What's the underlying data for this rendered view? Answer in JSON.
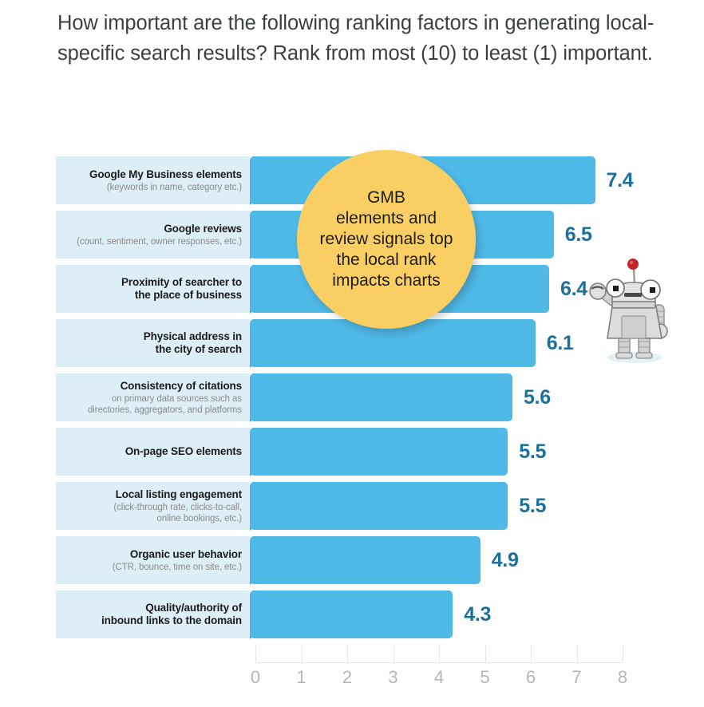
{
  "title": "How important are the following ranking factors in generating local- specific search results? Rank from most (10) to least (1) important.",
  "callout": {
    "text": "GMB\nelements and\nreview signals top\nthe local rank\nimpacts charts",
    "fill_color": "#f9cf63"
  },
  "colors": {
    "bar": "#4fb9e8",
    "bar_tail": "#2f9fd4",
    "label_band": "#ddeef7",
    "value_text": "#1d6f9e",
    "title_text": "#3c4043",
    "tick_text": "#b6b6b6"
  },
  "mascot": {
    "name": "robot-mascot",
    "body_color": "#d9d9d9",
    "antenna_color": "#c0252b"
  },
  "chart_data": {
    "type": "bar",
    "orientation": "horizontal",
    "title": "How important are the following ranking factors in generating local- specific search results? Rank from most (10) to least (1) important.",
    "xlabel": "",
    "ylabel": "",
    "xlim": [
      0,
      8
    ],
    "grid": false,
    "legend": null,
    "xticks": [
      0,
      1,
      2,
      3,
      4,
      5,
      6,
      7,
      8
    ],
    "categories": [
      "Google My Business elements",
      "Google reviews",
      "Proximity of searcher to the place of business",
      "Physical address in the city of search",
      "Consistency of citations",
      "On-page SEO elements",
      "Local listing engagement",
      "Organic user behavior",
      "Quality/authority of inbound links to the domain"
    ],
    "values": [
      7.4,
      6.5,
      6.4,
      6.1,
      5.6,
      5.5,
      5.5,
      4.9,
      4.3
    ],
    "rows": [
      {
        "label_main": "Google My Business elements",
        "label_sub": "(keywords in name, category etc.)",
        "value": 7.4,
        "value_text": "7.4"
      },
      {
        "label_main": "Google reviews",
        "label_sub": "(count, sentiment, owner responses, etc.)",
        "value": 6.5,
        "value_text": "6.5"
      },
      {
        "label_main": "Proximity of searcher to\nthe place of business",
        "label_sub": "",
        "value": 6.4,
        "value_text": "6.4"
      },
      {
        "label_main": "Physical address in\nthe city of search",
        "label_sub": "",
        "value": 6.1,
        "value_text": "6.1"
      },
      {
        "label_main": "Consistency of citations",
        "label_sub": "on primary data sources such as\ndirectories, aggregators, and platforms",
        "value": 5.6,
        "value_text": "5.6"
      },
      {
        "label_main": "On-page SEO elements",
        "label_sub": "",
        "value": 5.5,
        "value_text": "5.5"
      },
      {
        "label_main": "Local listing engagement",
        "label_sub": "(click-through rate, clicks-to-call,\nonline bookings, etc.)",
        "value": 5.5,
        "value_text": "5.5"
      },
      {
        "label_main": "Organic user behavior",
        "label_sub": "(CTR, bounce, time on site, etc.)",
        "value": 4.9,
        "value_text": "4.9"
      },
      {
        "label_main": "Quality/authority of\ninbound links to the domain",
        "label_sub": "",
        "value": 4.3,
        "value_text": "4.3"
      }
    ]
  }
}
